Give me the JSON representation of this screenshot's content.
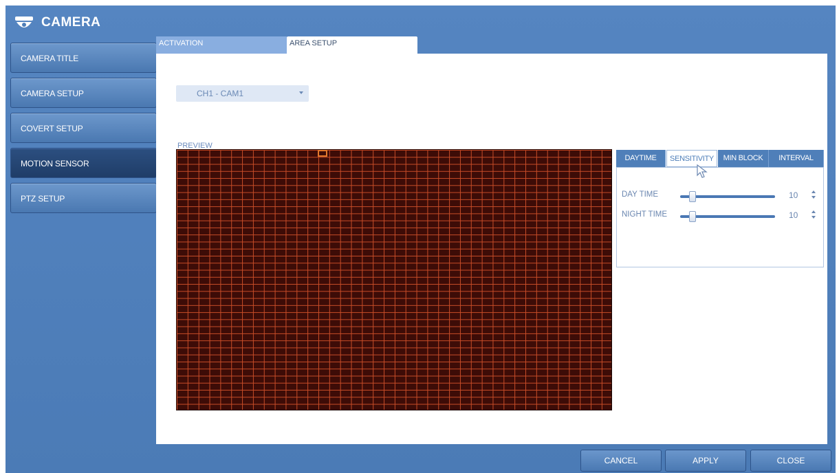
{
  "window": {
    "title": "CAMERA",
    "icon": "dome-camera-icon"
  },
  "sidebar": {
    "items": [
      {
        "label": "CAMERA TITLE",
        "active": false
      },
      {
        "label": "CAMERA SETUP",
        "active": false
      },
      {
        "label": "COVERT SETUP",
        "active": false
      },
      {
        "label": "MOTION SENSOR",
        "active": true
      },
      {
        "label": "PTZ SETUP",
        "active": false
      }
    ]
  },
  "tabs": [
    {
      "label": "ACTIVATION",
      "active": false
    },
    {
      "label": "AREA SETUP",
      "active": true
    }
  ],
  "channel_select": {
    "value": "CH1 - CAM1",
    "icon": "chevron-down-icon"
  },
  "preview": {
    "label": "PREVIEW"
  },
  "settings": {
    "tabs": [
      {
        "label": "DAYTIME",
        "active": false
      },
      {
        "label": "SENSITIVITY",
        "active": true
      },
      {
        "label": "MIN BLOCK",
        "active": false
      },
      {
        "label": "INTERVAL",
        "active": false
      }
    ],
    "sliders": [
      {
        "label": "DAY TIME",
        "value": "10"
      },
      {
        "label": "NIGHT TIME",
        "value": "10"
      }
    ]
  },
  "footer": {
    "cancel_label": "CANCEL",
    "apply_label": "APPLY",
    "close_label": "CLOSE"
  },
  "colors": {
    "frame": "#4f7fb9",
    "active_nav": "#2c4f80",
    "grid_line": "#c94d28",
    "grid_bg": "#3d0c07",
    "selected_cell": "#e47a2d"
  }
}
